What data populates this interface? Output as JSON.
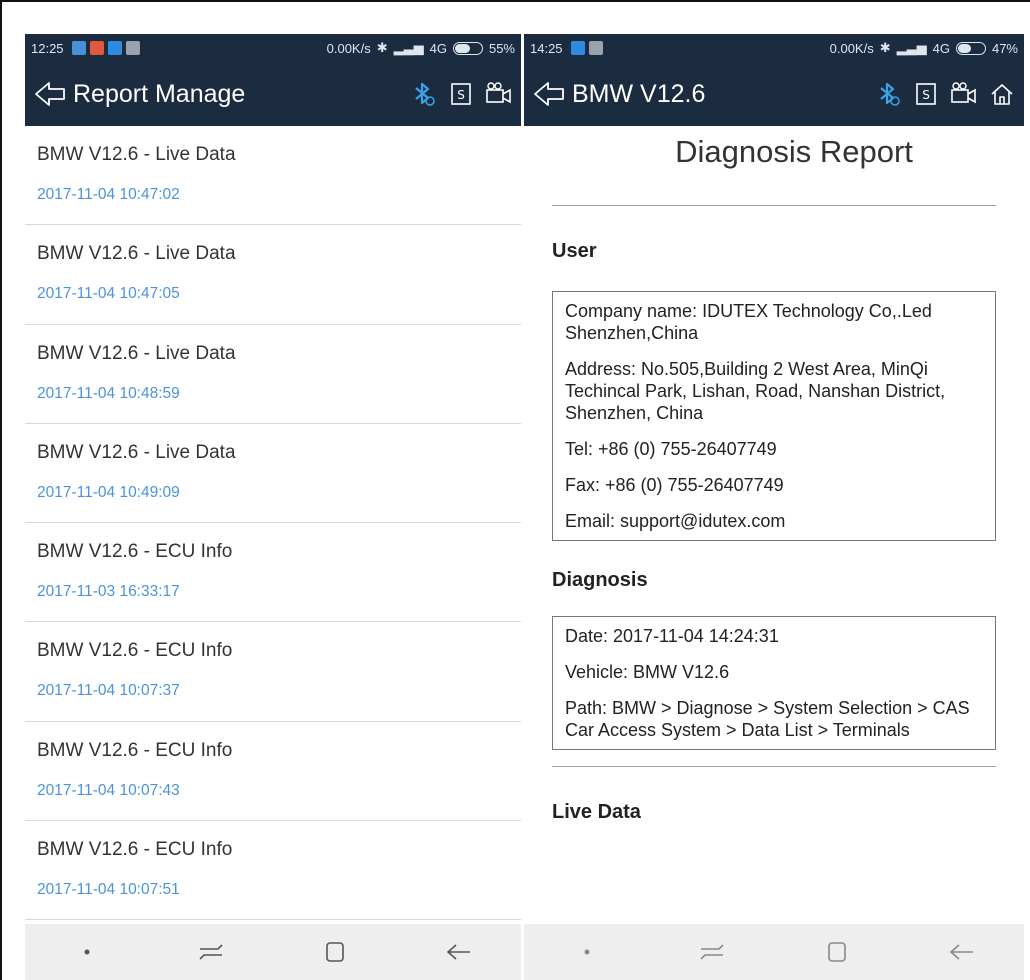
{
  "left": {
    "status": {
      "time": "12:25",
      "net_speed": "0.00K/s",
      "network": "4G",
      "battery": "55%",
      "battery_level": 0.55
    },
    "header": {
      "title": "Report Manage"
    },
    "reports": [
      {
        "name": "BMW V12.6 - Live Data",
        "date": "2017-11-04 10:47:02"
      },
      {
        "name": "BMW V12.6 - Live Data",
        "date": "2017-11-04 10:47:05"
      },
      {
        "name": "BMW V12.6 - Live Data",
        "date": "2017-11-04 10:48:59"
      },
      {
        "name": "BMW V12.6 - Live Data",
        "date": "2017-11-04 10:49:09"
      },
      {
        "name": "BMW V12.6 - ECU Info",
        "date": "2017-11-03 16:33:17"
      },
      {
        "name": "BMW V12.6 - ECU Info",
        "date": "2017-11-04 10:07:37"
      },
      {
        "name": "BMW V12.6 - ECU Info",
        "date": "2017-11-04 10:07:43"
      },
      {
        "name": "BMW V12.6 - ECU Info",
        "date": "2017-11-04 10:07:51"
      }
    ]
  },
  "right": {
    "status": {
      "time": "14:25",
      "net_speed": "0.00K/s",
      "network": "4G",
      "battery": "47%",
      "battery_level": 0.47
    },
    "header": {
      "title": "BMW V12.6"
    },
    "report": {
      "title": "Diagnosis Report",
      "user_heading": "User",
      "company": "Company name: IDUTEX Technology Co,.Led Shenzhen,China",
      "address": "Address: No.505,Building 2 West Area, MinQi Techincal Park, Lishan, Road, Nanshan District, Shenzhen, China",
      "tel": "Tel: +86 (0) 755-26407749",
      "fax": "Fax: +86 (0) 755-26407749",
      "email": "Email: support@idutex.com",
      "diagnosis_heading": "Diagnosis",
      "date": "Date: 2017-11-04 14:24:31",
      "vehicle": "Vehicle: BMW V12.6",
      "path": "Path: BMW > Diagnose > System Selection > CAS Car Access System > Data List > Terminals",
      "live_data_heading": "Live Data"
    }
  },
  "colors": {
    "bar": "#1b2b40",
    "date_text": "#4a93dc",
    "bluetooth": "#3aa3e8",
    "navbar": "#eeeeee"
  }
}
